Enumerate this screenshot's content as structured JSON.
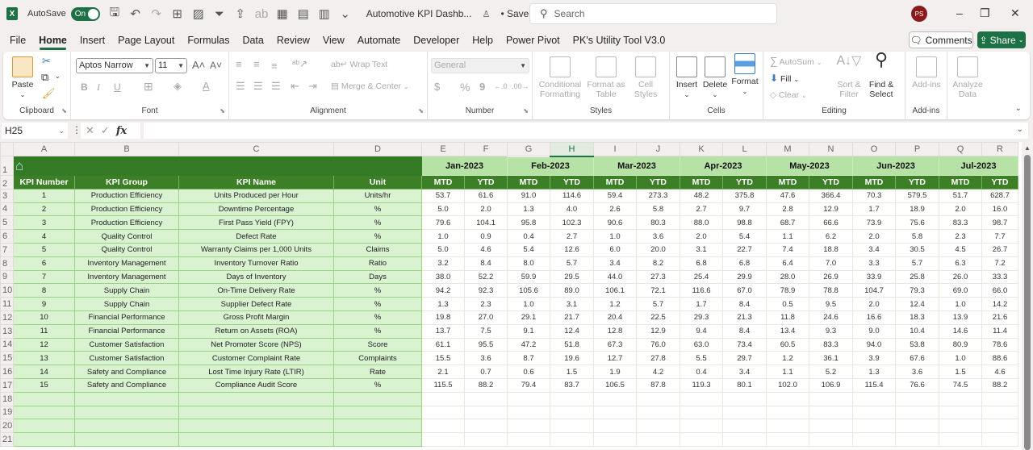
{
  "titlebar": {
    "app_icon": "X",
    "autosave_label": "AutoSave",
    "autosave_state": "On",
    "doc_title": "Automotive KPI Dashb...",
    "saved_status": "• Saved",
    "search_placeholder": "Search",
    "user_initials": "PS",
    "minimize": "–",
    "restore": "❐",
    "close": "✕"
  },
  "menu": {
    "tabs": [
      "File",
      "Home",
      "Insert",
      "Page Layout",
      "Formulas",
      "Data",
      "Review",
      "View",
      "Automate",
      "Developer",
      "Help",
      "Power Pivot",
      "PK's Utility Tool V3.0"
    ],
    "active_tab": "Home",
    "comments_label": "Comments",
    "share_label": "Share"
  },
  "ribbon": {
    "clipboard": {
      "label": "Clipboard",
      "paste": "Paste"
    },
    "font": {
      "label": "Font",
      "font_name": "Aptos Narrow",
      "font_size": "11",
      "bold": "B",
      "italic": "I",
      "underline": "U"
    },
    "alignment": {
      "label": "Alignment",
      "wrap_text": "Wrap Text",
      "merge_center": "Merge & Center"
    },
    "number": {
      "label": "Number",
      "format": "General",
      "currency": "$",
      "percent": "%",
      "comma": "9"
    },
    "styles": {
      "label": "Styles",
      "conditional": "Conditional Formatting",
      "format_table": "Format as Table",
      "cell_styles": "Cell Styles"
    },
    "cells": {
      "label": "Cells",
      "insert": "Insert",
      "delete": "Delete",
      "format": "Format"
    },
    "editing": {
      "label": "Editing",
      "autosum": "AutoSum",
      "fill": "Fill",
      "clear": "Clear",
      "sort_filter": "Sort & Filter",
      "find_select": "Find & Select"
    },
    "addins": {
      "label": "Add-ins",
      "addins_btn": "Add-ins",
      "analyze": "Analyze Data"
    }
  },
  "formula_bar": {
    "name_box": "H25",
    "formula": ""
  },
  "sheet": {
    "columns": [
      "A",
      "B",
      "C",
      "D",
      "E",
      "F",
      "G",
      "H",
      "I",
      "J",
      "K",
      "L",
      "M",
      "N",
      "O",
      "P",
      "Q",
      "R"
    ],
    "selected_column": "H",
    "rows_visible": [
      "1",
      "2",
      "3",
      "4",
      "5",
      "6",
      "7",
      "8",
      "9",
      "10",
      "11",
      "12",
      "13",
      "14",
      "15",
      "16",
      "17",
      "18",
      "19",
      "20",
      "21"
    ],
    "headers": {
      "kpi_number": "KPI Number",
      "kpi_group": "KPI Group",
      "kpi_name": "KPI Name",
      "unit": "Unit",
      "mtd": "MTD",
      "ytd": "YTD"
    },
    "months": [
      "Jan-2023",
      "Feb-2023",
      "Mar-2023",
      "Apr-2023",
      "May-2023",
      "Jun-2023",
      "Jul-2023"
    ],
    "kpis": [
      {
        "num": "1",
        "group": "Production Efficiency",
        "name": "Units Produced per Hour",
        "unit": "Units/hr",
        "values": [
          "53.7",
          "61.6",
          "91.0",
          "114.6",
          "59.4",
          "273.3",
          "48.2",
          "375.8",
          "47.6",
          "366.4",
          "70.3",
          "579.5",
          "51.7",
          "628.7"
        ]
      },
      {
        "num": "2",
        "group": "Production Efficiency",
        "name": "Downtime Percentage",
        "unit": "%",
        "values": [
          "5.0",
          "2.0",
          "1.3",
          "4.0",
          "2.6",
          "5.8",
          "2.7",
          "9.7",
          "2.8",
          "12.9",
          "1.7",
          "18.9",
          "2.0",
          "16.0"
        ]
      },
      {
        "num": "3",
        "group": "Production Efficiency",
        "name": "First Pass Yield (FPY)",
        "unit": "%",
        "values": [
          "79.6",
          "104.1",
          "95.8",
          "102.3",
          "90.6",
          "80.3",
          "88.0",
          "98.8",
          "68.7",
          "66.6",
          "73.9",
          "75.6",
          "83.3",
          "98.7"
        ]
      },
      {
        "num": "4",
        "group": "Quality Control",
        "name": "Defect Rate",
        "unit": "%",
        "values": [
          "1.0",
          "0.9",
          "0.4",
          "2.7",
          "1.0",
          "3.6",
          "2.0",
          "5.4",
          "1.1",
          "6.2",
          "2.0",
          "5.8",
          "2.3",
          "7.7"
        ]
      },
      {
        "num": "5",
        "group": "Quality Control",
        "name": "Warranty Claims per 1,000 Units",
        "unit": "Claims",
        "values": [
          "5.0",
          "4.6",
          "5.4",
          "12.6",
          "6.0",
          "20.0",
          "3.1",
          "22.7",
          "7.4",
          "18.8",
          "3.4",
          "30.5",
          "4.5",
          "26.7"
        ]
      },
      {
        "num": "6",
        "group": "Inventory Management",
        "name": "Inventory Turnover Ratio",
        "unit": "Ratio",
        "values": [
          "3.2",
          "8.4",
          "8.0",
          "5.7",
          "3.4",
          "8.2",
          "6.8",
          "6.8",
          "6.4",
          "7.0",
          "3.3",
          "5.7",
          "6.3",
          "7.2"
        ]
      },
      {
        "num": "7",
        "group": "Inventory Management",
        "name": "Days of Inventory",
        "unit": "Days",
        "values": [
          "38.0",
          "52.2",
          "59.9",
          "29.5",
          "44.0",
          "27.3",
          "25.4",
          "29.9",
          "28.0",
          "26.9",
          "33.9",
          "25.8",
          "26.0",
          "33.3"
        ]
      },
      {
        "num": "8",
        "group": "Supply Chain",
        "name": "On-Time Delivery Rate",
        "unit": "%",
        "values": [
          "94.2",
          "92.3",
          "105.6",
          "89.0",
          "106.1",
          "72.1",
          "116.6",
          "67.0",
          "78.9",
          "78.8",
          "104.7",
          "79.3",
          "69.0",
          "66.0"
        ]
      },
      {
        "num": "9",
        "group": "Supply Chain",
        "name": "Supplier Defect Rate",
        "unit": "%",
        "values": [
          "1.3",
          "2.3",
          "1.0",
          "3.1",
          "1.2",
          "5.7",
          "1.7",
          "8.4",
          "0.5",
          "9.5",
          "2.0",
          "12.4",
          "1.0",
          "14.2"
        ]
      },
      {
        "num": "10",
        "group": "Financial Performance",
        "name": "Gross Profit Margin",
        "unit": "%",
        "values": [
          "19.8",
          "27.0",
          "29.1",
          "21.7",
          "20.4",
          "22.5",
          "29.3",
          "21.3",
          "11.8",
          "24.6",
          "16.6",
          "18.3",
          "13.9",
          "21.6"
        ]
      },
      {
        "num": "11",
        "group": "Financial Performance",
        "name": "Return on Assets (ROA)",
        "unit": "%",
        "values": [
          "13.7",
          "7.5",
          "9.1",
          "12.4",
          "12.8",
          "12.9",
          "9.4",
          "8.4",
          "13.4",
          "9.3",
          "9.0",
          "10.4",
          "14.6",
          "11.4"
        ]
      },
      {
        "num": "12",
        "group": "Customer Satisfaction",
        "name": "Net Promoter Score (NPS)",
        "unit": "Score",
        "values": [
          "61.1",
          "95.5",
          "47.2",
          "51.8",
          "67.3",
          "76.0",
          "63.0",
          "73.4",
          "60.5",
          "83.3",
          "94.0",
          "53.8",
          "80.9",
          "78.6"
        ]
      },
      {
        "num": "13",
        "group": "Customer Satisfaction",
        "name": "Customer Complaint Rate",
        "unit": "Complaints",
        "values": [
          "15.5",
          "3.6",
          "8.7",
          "19.6",
          "12.7",
          "27.8",
          "5.5",
          "29.7",
          "1.2",
          "36.1",
          "3.9",
          "67.6",
          "1.0",
          "88.6"
        ]
      },
      {
        "num": "14",
        "group": "Safety and Compliance",
        "name": "Lost Time Injury Rate (LTIR)",
        "unit": "Rate",
        "values": [
          "2.1",
          "0.7",
          "0.6",
          "1.5",
          "1.9",
          "4.2",
          "0.4",
          "3.4",
          "1.1",
          "5.2",
          "1.3",
          "3.6",
          "1.5",
          "4.6"
        ]
      },
      {
        "num": "15",
        "group": "Safety and Compliance",
        "name": "Compliance Audit Score",
        "unit": "%",
        "values": [
          "115.5",
          "88.2",
          "79.4",
          "83.7",
          "106.5",
          "87.8",
          "119.3",
          "80.1",
          "102.0",
          "106.9",
          "115.4",
          "76.6",
          "74.5",
          "88.2"
        ]
      }
    ],
    "empty_rows": [
      "18",
      "19",
      "20",
      "21"
    ]
  },
  "colors": {
    "brand_green": "#1e7145",
    "header_dark_green": "#3d7f26",
    "month_light_green": "#b6e3a5",
    "left_cell_green": "#d9f2d0"
  }
}
